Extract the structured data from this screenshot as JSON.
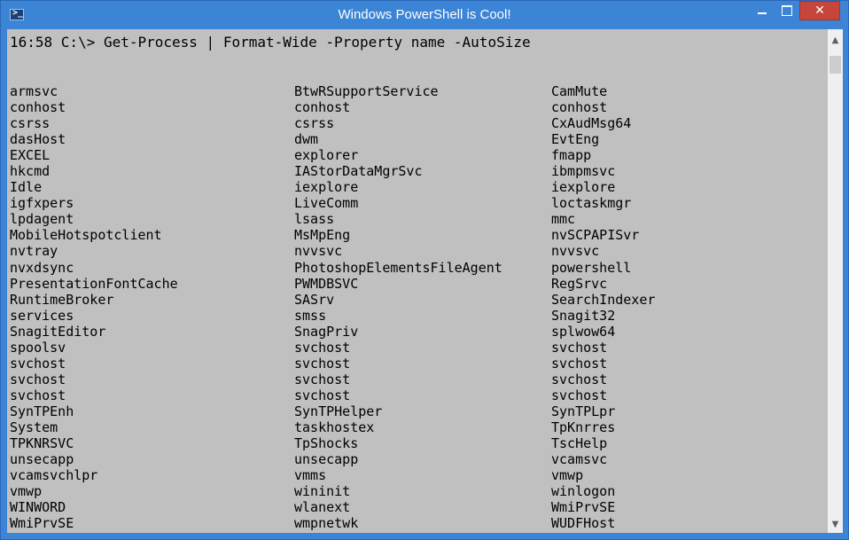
{
  "window": {
    "title": "Windows PowerShell is Cool!",
    "icon": "powershell-icon",
    "icon_glyph": ">_",
    "controls": {
      "minimize": "minimize-icon",
      "maximize": "maximize-icon",
      "close_label": "✕"
    },
    "colors": {
      "titlebar": "#3c84d6",
      "console_bg": "#c0c0c0",
      "text": "#000000",
      "close": "#c7463c"
    }
  },
  "console": {
    "prompt": "16:58 C:\\> Get-Process | Format-Wide -Property name -AutoSize",
    "columns": [
      [
        "armsvc",
        "conhost",
        "csrss",
        "dasHost",
        "EXCEL",
        "hkcmd",
        "Idle",
        "igfxpers",
        "lpdagent",
        "MobileHotspotclient",
        "nvtray",
        "nvxdsync",
        "PresentationFontCache",
        "RuntimeBroker",
        "services",
        "SnagitEditor",
        "spoolsv",
        "svchost",
        "svchost",
        "svchost",
        "SynTPEnh",
        "System",
        "TPKNRSVC",
        "unsecapp",
        "vcamsvchlpr",
        "vmwp",
        "WINWORD",
        "WmiPrvSE"
      ],
      [
        "BtwRSupportService",
        "conhost",
        "csrss",
        "dwm",
        "explorer",
        "IAStorDataMgrSvc",
        "iexplore",
        "LiveComm",
        "lsass",
        "MsMpEng",
        "nvvsvc",
        "PhotoshopElementsFileAgent",
        "PWMDBSVC",
        "SASrv",
        "smss",
        "SnagPriv",
        "svchost",
        "svchost",
        "svchost",
        "svchost",
        "SynTPHelper",
        "taskhostex",
        "TpShocks",
        "unsecapp",
        "vmms",
        "wininit",
        "wlanext",
        "wmpnetwk"
      ],
      [
        "CamMute",
        "conhost",
        "CxAudMsg64",
        "EvtEng",
        "fmapp",
        "ibmpmsvc",
        "iexplore",
        "loctaskmgr",
        "mmc",
        "nvSCPAPISvr",
        "nvvsvc",
        "powershell",
        "RegSrvc",
        "SearchIndexer",
        "Snagit32",
        "splwow64",
        "svchost",
        "svchost",
        "svchost",
        "svchost",
        "SynTPLpr",
        "TpKnrres",
        "TscHelp",
        "vcamsvc",
        "vmwp",
        "winlogon",
        "WmiPrvSE",
        "WUDFHost"
      ]
    ]
  },
  "scrollbar": {
    "up": "▲",
    "down": "▼"
  }
}
